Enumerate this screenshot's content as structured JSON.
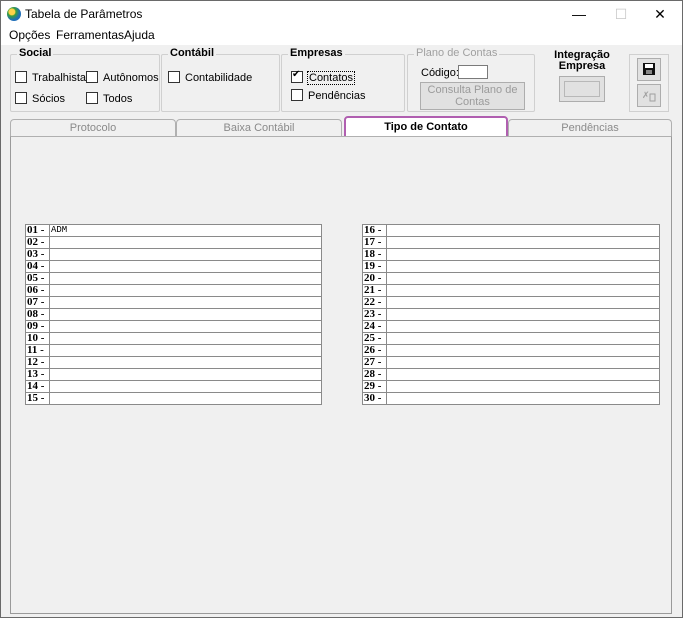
{
  "window": {
    "title": "Tabela de Parâmetros"
  },
  "menu": {
    "items": [
      "Opções",
      "Ferramentas",
      "Ajuda"
    ]
  },
  "social": {
    "title": "Social",
    "trabalhista": "Trabalhista",
    "autonomos": "Autônomos",
    "socios": "Sócios",
    "todos": "Todos"
  },
  "contabil": {
    "title": "Contábil",
    "contabilidade": "Contabilidade"
  },
  "empresas": {
    "title": "Empresas",
    "contatos": "Contatos",
    "pendencias": "Pendências"
  },
  "plano": {
    "title": "Plano de Contas",
    "codigo_label": "Código:",
    "codigo_value": "",
    "consulta_label": "Consulta Plano de Contas"
  },
  "integracao": {
    "title": "Integração Empresa"
  },
  "tabs": [
    "Protocolo",
    "Baixa Contábil",
    "Tipo de Contato",
    "Pendências"
  ],
  "contact_types_left": [
    {
      "num": "01",
      "value": "ADM"
    },
    {
      "num": "02",
      "value": ""
    },
    {
      "num": "03",
      "value": ""
    },
    {
      "num": "04",
      "value": ""
    },
    {
      "num": "05",
      "value": ""
    },
    {
      "num": "06",
      "value": ""
    },
    {
      "num": "07",
      "value": ""
    },
    {
      "num": "08",
      "value": ""
    },
    {
      "num": "09",
      "value": ""
    },
    {
      "num": "10",
      "value": ""
    },
    {
      "num": "11",
      "value": ""
    },
    {
      "num": "12",
      "value": ""
    },
    {
      "num": "13",
      "value": ""
    },
    {
      "num": "14",
      "value": ""
    },
    {
      "num": "15",
      "value": ""
    }
  ],
  "contact_types_right": [
    {
      "num": "16",
      "value": ""
    },
    {
      "num": "17",
      "value": ""
    },
    {
      "num": "18",
      "value": ""
    },
    {
      "num": "19",
      "value": ""
    },
    {
      "num": "20",
      "value": ""
    },
    {
      "num": "21",
      "value": ""
    },
    {
      "num": "22",
      "value": ""
    },
    {
      "num": "23",
      "value": ""
    },
    {
      "num": "24",
      "value": ""
    },
    {
      "num": "25",
      "value": ""
    },
    {
      "num": "26",
      "value": ""
    },
    {
      "num": "27",
      "value": ""
    },
    {
      "num": "28",
      "value": ""
    },
    {
      "num": "29",
      "value": ""
    },
    {
      "num": "30",
      "value": ""
    }
  ]
}
